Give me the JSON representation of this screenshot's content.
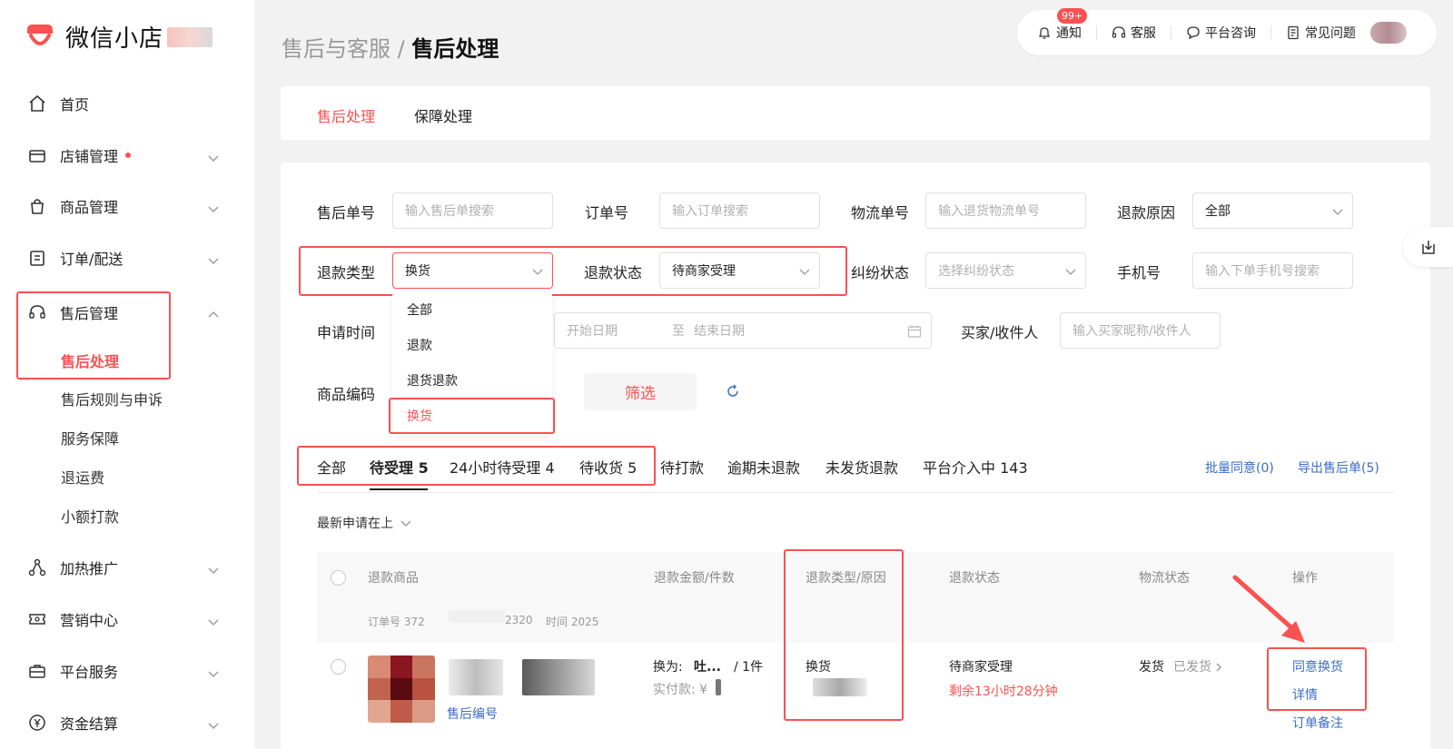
{
  "sidebar": {
    "brand": "微信小店",
    "items": [
      {
        "label": "首页"
      },
      {
        "label": "店铺管理"
      },
      {
        "label": "商品管理"
      },
      {
        "label": "订单/配送"
      },
      {
        "label": "售后管理"
      },
      {
        "label": "加热推广"
      },
      {
        "label": "营销中心"
      },
      {
        "label": "平台服务"
      },
      {
        "label": "资金结算"
      }
    ],
    "aftersale_subitems": [
      {
        "label": "售后处理"
      },
      {
        "label": "售后规则与申诉"
      },
      {
        "label": "服务保障"
      },
      {
        "label": "退运费"
      },
      {
        "label": "小额打款"
      }
    ]
  },
  "breadcrumb": {
    "parent": "售后与客服",
    "separator": " / ",
    "current": "售后处理"
  },
  "topbar": {
    "notify_label": "通知",
    "notify_badge": "99+",
    "service_label": "客服",
    "consult_label": "平台咨询",
    "faq_label": "常见问题"
  },
  "page_tabs": [
    {
      "label": "售后处理"
    },
    {
      "label": "保障处理"
    }
  ],
  "filters": {
    "aftersale_no": {
      "label": "售后单号",
      "placeholder": "输入售后单搜索"
    },
    "order_no": {
      "label": "订单号",
      "placeholder": "输入订单搜索"
    },
    "logistics_no": {
      "label": "物流单号",
      "placeholder": "输入退货物流单号"
    },
    "refund_reason": {
      "label": "退款原因",
      "value": "全部"
    },
    "refund_type": {
      "label": "退款类型",
      "value": "换货"
    },
    "refund_status": {
      "label": "退款状态",
      "value": "待商家受理"
    },
    "dispute_status": {
      "label": "纠纷状态",
      "placeholder": "选择纠纷状态"
    },
    "phone": {
      "label": "手机号",
      "placeholder": "输入下单手机号搜索"
    },
    "apply_time": {
      "label": "申请时间",
      "start_placeholder": "开始日期",
      "to": "至",
      "end_placeholder": "结束日期"
    },
    "buyer": {
      "label": "买家/收件人",
      "placeholder": "输入买家昵称/收件人"
    },
    "product_code": {
      "label": "商品编码"
    },
    "filter_button": "筛选"
  },
  "refund_type_options": [
    {
      "label": "全部"
    },
    {
      "label": "退款"
    },
    {
      "label": "退货退款"
    },
    {
      "label": "换货"
    }
  ],
  "status_tabs": [
    {
      "label": "全部"
    },
    {
      "label": "待受理 5"
    },
    {
      "label": "24小时待受理 4"
    },
    {
      "label": "待收货 5"
    },
    {
      "label": "待打款"
    },
    {
      "label": "逾期未退款"
    },
    {
      "label": "未发货退款"
    },
    {
      "label": "平台介入中 143"
    }
  ],
  "bulk_actions": {
    "batch_agree": "批量同意(0)",
    "export": "导出售后单(5)"
  },
  "sort_label": "最新申请在上",
  "table": {
    "headers": [
      "退款商品",
      "退款金额/件数",
      "退款类型/原因",
      "退款状态",
      "物流状态",
      "操作"
    ],
    "order_line": {
      "order_prefix": "订单号 372",
      "order_suffix": "2320",
      "time_label": "时间 2025"
    },
    "row": {
      "aftersale_link": "售后编号",
      "exchange_for_label": "换为:",
      "exchange_for_value": "吐...",
      "qty": "/ 1件",
      "paid_label": "实付款: ¥",
      "refund_type": "换货",
      "status": "待商家受理",
      "countdown": "剩余13小时28分钟",
      "logistics_label": "发货",
      "logistics_value": "已发货",
      "actions": [
        "同意换货",
        "详情",
        "订单备注"
      ]
    }
  },
  "colors": {
    "accent": "#fa5151",
    "link": "#3a6dc7"
  }
}
